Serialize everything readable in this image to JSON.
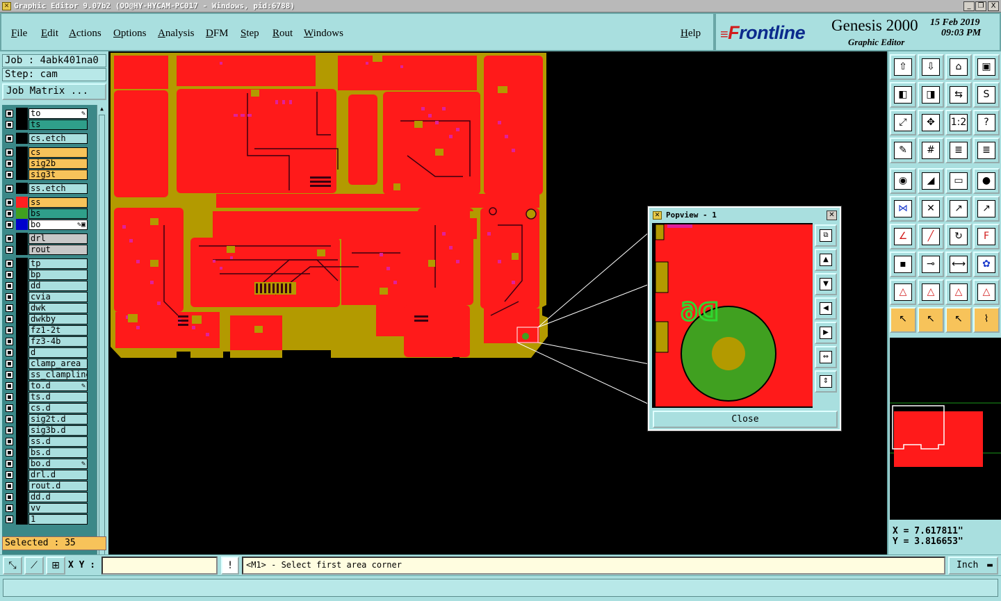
{
  "window": {
    "title": "Graphic Editor 9.07b2 (OO@HY-HYCAM-PC017 - Windows, pid:6788)",
    "controls": [
      "_",
      "❐",
      "X"
    ]
  },
  "menu": {
    "items": [
      "File",
      "Edit",
      "Actions",
      "Options",
      "Analysis",
      "DFM",
      "Step",
      "Rout",
      "Windows"
    ],
    "help": "Help"
  },
  "brand": {
    "logo_prefix": "F",
    "logo_rest": "rontline",
    "product": "Genesis 2000",
    "subtitle": "Graphic Editor",
    "date": "15 Feb 2019",
    "time": "09:03 PM"
  },
  "job": {
    "job_label": "Job : 4abk401na0",
    "step_label": "Step: cam",
    "matrix_button": "Job Matrix ..."
  },
  "layers": [
    {
      "name": "to",
      "color": "#ffffff",
      "mark": "✎"
    },
    {
      "name": "ts",
      "color": "#2f9f8a"
    },
    {
      "name": "cs.etch",
      "color": "#a9dfdf",
      "gap": true
    },
    {
      "name": "cs",
      "color": "#f7c35a",
      "gap": true
    },
    {
      "name": "sig2b",
      "color": "#f7c35a"
    },
    {
      "name": "sig3t",
      "color": "#f7c35a"
    },
    {
      "name": "ss.etch",
      "color": "#a9dfdf",
      "gap": true
    },
    {
      "name": "ss",
      "color": "#f7c35a",
      "swatch": "#ff2020",
      "gap": true
    },
    {
      "name": "bs",
      "color": "#2f9f8a",
      "swatch": "#40a020"
    },
    {
      "name": "bo",
      "color": "#ffffff",
      "swatch": "#0000cc",
      "mark": "✎▣"
    },
    {
      "name": "drl",
      "color": "#c8c8c8",
      "gap": true
    },
    {
      "name": "rout",
      "color": "#c8c8c8"
    },
    {
      "name": "tp",
      "color": "#a9dfdf",
      "gap": true
    },
    {
      "name": "bp",
      "color": "#a9dfdf"
    },
    {
      "name": "dd",
      "color": "#a9dfdf"
    },
    {
      "name": "cvia",
      "color": "#a9dfdf"
    },
    {
      "name": "dwk",
      "color": "#a9dfdf"
    },
    {
      "name": "dwkby",
      "color": "#a9dfdf"
    },
    {
      "name": "fz1-2t",
      "color": "#a9dfdf"
    },
    {
      "name": "fz3-4b",
      "color": "#a9dfdf"
    },
    {
      "name": "d",
      "color": "#a9dfdf"
    },
    {
      "name": "clamp_area",
      "color": "#a9dfdf"
    },
    {
      "name": "ss_clampline",
      "color": "#a9dfdf"
    },
    {
      "name": "to.d",
      "color": "#a9dfdf",
      "mark": "✎"
    },
    {
      "name": "ts.d",
      "color": "#a9dfdf"
    },
    {
      "name": "cs.d",
      "color": "#a9dfdf"
    },
    {
      "name": "sig2t.d",
      "color": "#a9dfdf"
    },
    {
      "name": "sig3b.d",
      "color": "#a9dfdf"
    },
    {
      "name": "ss.d",
      "color": "#a9dfdf"
    },
    {
      "name": "bs.d",
      "color": "#a9dfdf"
    },
    {
      "name": "bo.d",
      "color": "#a9dfdf",
      "mark": "✎"
    },
    {
      "name": "drl.d",
      "color": "#a9dfdf"
    },
    {
      "name": "rout.d",
      "color": "#a9dfdf"
    },
    {
      "name": "dd.d",
      "color": "#a9dfdf"
    },
    {
      "name": "vv",
      "color": "#a9dfdf"
    },
    {
      "name": "1",
      "color": "#a9dfdf"
    }
  ],
  "selected": "Selected : 35",
  "popview": {
    "title": "Popview - 1",
    "close_label": "Close",
    "feature_label": "D6"
  },
  "coords": {
    "x": "X = 7.617811\"",
    "y": "Y = 3.816653\""
  },
  "status": {
    "xy_label": "X Y :",
    "xy_value": "",
    "prompt": "<M1> - Select first area corner",
    "units": "Inch"
  },
  "tool_icons": [
    "upload-icon",
    "download-icon",
    "home-icon",
    "window-icon",
    "left-icon",
    "right-icon",
    "mirror-icon",
    "s-icon",
    "fit-icon",
    "center-icon",
    "ratio-icon",
    "help-icon",
    "edit-icon",
    "grid-icon",
    "layer-icon",
    "layer2-icon",
    "select-icon",
    "measure-icon",
    "ruler-icon",
    "circle-icon",
    "net-icon",
    "cross-icon",
    "snap-icon",
    "snap2-icon",
    "line-icon",
    "line2-icon",
    "arc-icon",
    "text-icon",
    "pad-icon",
    "edge-icon",
    "dim-icon",
    "shape-icon",
    "tri-icon",
    "tri2-icon",
    "tri3-icon",
    "tri4-icon",
    "pointer-icon",
    "pointer2-icon",
    "pointer3-icon",
    "route-icon"
  ]
}
